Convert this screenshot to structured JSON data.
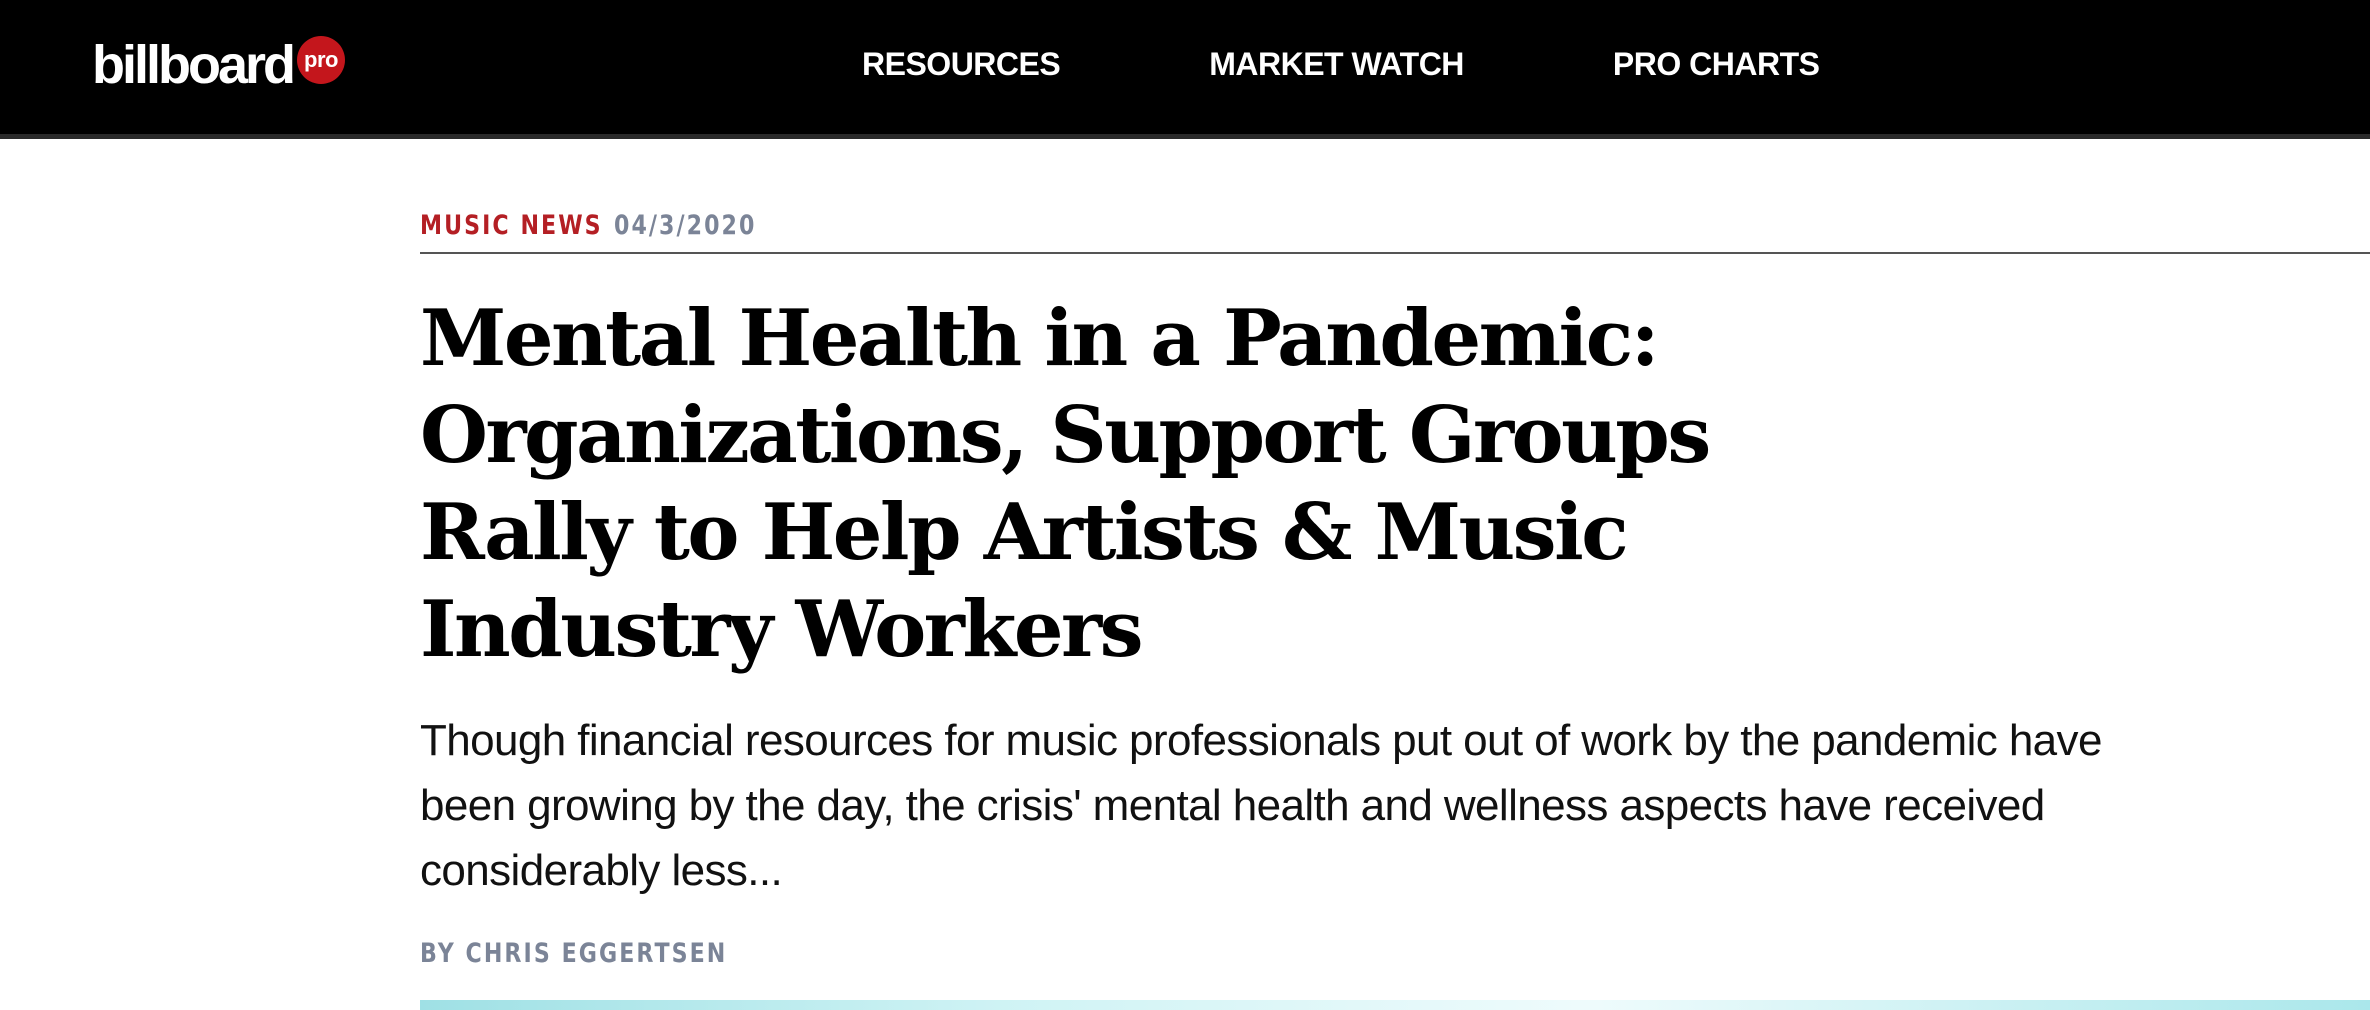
{
  "header": {
    "logo_word": "billboard",
    "logo_badge": "pro",
    "nav": [
      {
        "label": "RESOURCES"
      },
      {
        "label": "MARKET WATCH"
      },
      {
        "label": "PRO CHARTS"
      }
    ]
  },
  "article": {
    "category": "MUSIC NEWS",
    "date": "04/3/2020",
    "headline": "Mental Health in a Pandemic: Organizations, Support Groups Rally to Help Artists & Music Industry Workers",
    "dek": "Though financial resources for music professionals put out of work by the pandemic have been growing by the day, the crisis' mental health and wellness aspects have received considerably less...",
    "byline": "BY CHRIS EGGERTSEN"
  },
  "colors": {
    "accent_red": "#c4161c",
    "category_red": "#b41f24",
    "meta_gray": "#7b8497",
    "nav_background": "#000000"
  }
}
